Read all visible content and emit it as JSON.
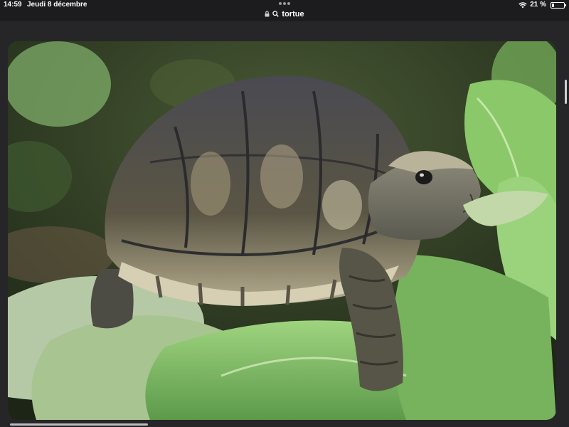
{
  "status_bar": {
    "time": "14:59",
    "date": "Jeudi 8 décembre",
    "battery_text": "21 %",
    "battery_level": 0.21,
    "wifi_icon": "wifi-icon"
  },
  "address_bar": {
    "query": "tortue",
    "lock_icon": "lock-icon",
    "search_icon": "search-icon"
  },
  "image": {
    "subject": "photo"
  },
  "colors": {
    "background": "#1c1c1e",
    "foliage": "#7fb56a",
    "shell_dark": "#3a3a3a",
    "shell_light": "#cfc7a8"
  }
}
